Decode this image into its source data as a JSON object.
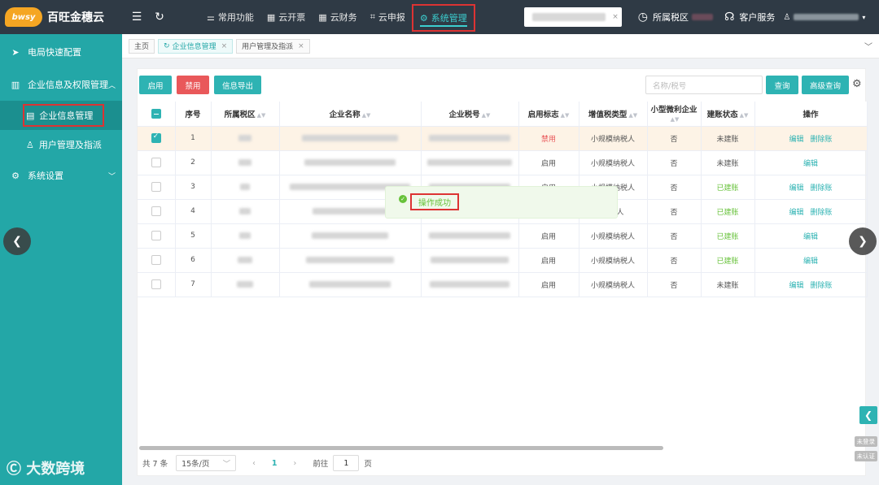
{
  "app": {
    "logo_text": "bwsy",
    "name": "百旺金穗云"
  },
  "topnav": [
    {
      "label": "常用功能",
      "icon": "sliders-icon"
    },
    {
      "label": "云开票",
      "icon": "grid-icon"
    },
    {
      "label": "云财务",
      "icon": "grid-icon"
    },
    {
      "label": "云申报",
      "icon": "crop-icon"
    },
    {
      "label": "系统管理",
      "icon": "gear-icon",
      "active": true
    }
  ],
  "header_right": {
    "tax_region_label": "所属税区",
    "service_label": "客户服务"
  },
  "sidebar": {
    "items": [
      {
        "label": "电局快速配置",
        "icon": "send-icon"
      },
      {
        "label": "企业信息及权限管理",
        "icon": "building-icon",
        "expanded": true,
        "children": [
          {
            "label": "企业信息管理",
            "icon": "office-icon",
            "active": true
          },
          {
            "label": "用户管理及指派",
            "icon": "user-icon"
          }
        ]
      },
      {
        "label": "系统设置",
        "icon": "gear-icon"
      }
    ],
    "watermark": "大数跨境"
  },
  "tabs": [
    {
      "label": "主页",
      "closable": false
    },
    {
      "label": "企业信息管理",
      "closable": true,
      "active": true
    },
    {
      "label": "用户管理及指派",
      "closable": true
    }
  ],
  "toolbar": {
    "enable_label": "启用",
    "disable_label": "禁用",
    "export_label": "信息导出",
    "search_placeholder": "名称/税号",
    "query_label": "查询",
    "advanced_label": "高级查询"
  },
  "table": {
    "headers": [
      "序号",
      "所属税区",
      "企业名称",
      "企业税号",
      "启用标志",
      "增值税类型",
      "小型微利企业",
      "建账状态",
      "操作"
    ],
    "rows": [
      {
        "no": "1",
        "enable": "禁用",
        "vat": "小规模纳税人",
        "small": "否",
        "status": "未建账",
        "actions": [
          "编辑",
          "删除账"
        ],
        "selected": true
      },
      {
        "no": "2",
        "enable": "启用",
        "vat": "小规模纳税人",
        "small": "否",
        "status": "未建账",
        "actions": [
          "编辑"
        ]
      },
      {
        "no": "3",
        "enable": "启用",
        "vat": "小规模纳税人",
        "small": "否",
        "status": "已建账",
        "actions": [
          "编辑",
          "删除账"
        ]
      },
      {
        "no": "4",
        "enable": "",
        "vat": "纳税人",
        "small": "否",
        "status": "已建账",
        "actions": [
          "编辑",
          "删除账"
        ]
      },
      {
        "no": "5",
        "enable": "启用",
        "vat": "小规模纳税人",
        "small": "否",
        "status": "已建账",
        "actions": [
          "编辑"
        ]
      },
      {
        "no": "6",
        "enable": "启用",
        "vat": "小规模纳税人",
        "small": "否",
        "status": "已建账",
        "actions": [
          "编辑"
        ]
      },
      {
        "no": "7",
        "enable": "启用",
        "vat": "小规模纳税人",
        "small": "否",
        "status": "未建账",
        "actions": [
          "编辑",
          "删除账"
        ]
      }
    ]
  },
  "toast": {
    "message": "操作成功"
  },
  "pagination": {
    "total": "共 7 条",
    "page_size": "15条/页",
    "current": "1",
    "goto_label": "前往",
    "goto_value": "1",
    "page_suffix": "页"
  },
  "badges": {
    "not_logged_in": "未登录",
    "not_verified": "未认证"
  },
  "colors": {
    "sidebar": "#23a7a7",
    "topbar": "#2f3a45",
    "accent": "#2eb3b3",
    "danger": "#e9585a",
    "success": "#67c23a"
  }
}
